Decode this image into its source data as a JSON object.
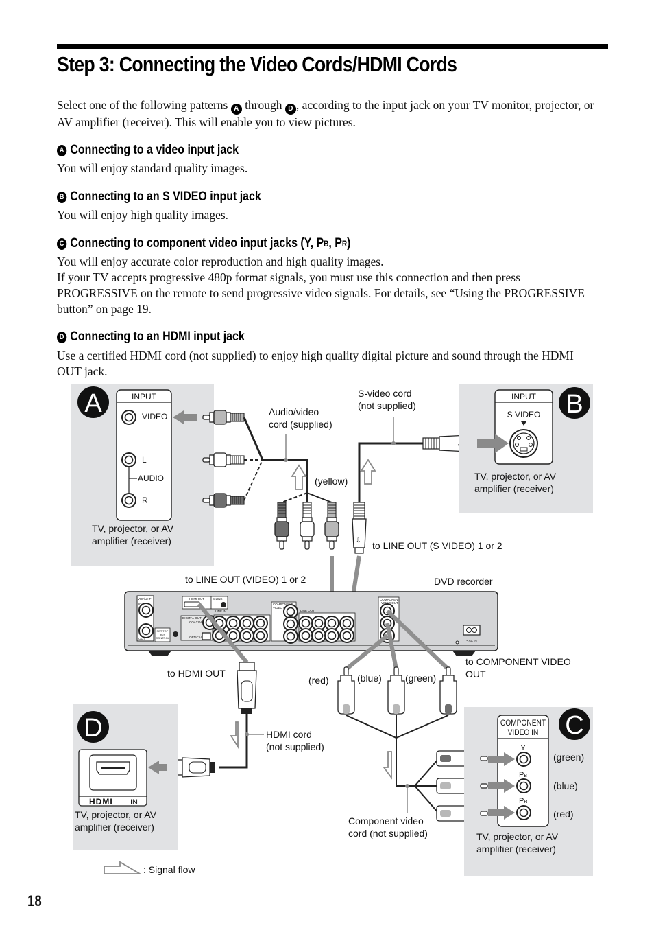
{
  "page": {
    "title": "Step 3: Connecting the Video Cords/HDMI Cords",
    "intro_before": "Select one of the following patterns ",
    "intro_badge_start": "A",
    "intro_mid": " through ",
    "intro_badge_end": "D",
    "intro_after": ", according to the input jack on your TV monitor, projector, or AV amplifier (receiver). This will enable you to view pictures.",
    "page_number": "18"
  },
  "sections": [
    {
      "badge": "A",
      "heading": "Connecting to a video input jack",
      "body": "You will enjoy standard quality images."
    },
    {
      "badge": "B",
      "heading": "Connecting to an S VIDEO input jack",
      "body": "You will enjoy high quality images."
    },
    {
      "badge": "C",
      "heading_main": "Connecting to component video input jacks (Y, P",
      "heading_sub1": "B",
      "heading_sep": ", P",
      "heading_sub2": "R",
      "heading_end": ")",
      "body1": "You will enjoy accurate color reproduction and high quality images.",
      "body2": "If your TV accepts progressive 480p format signals, you must use this connection and then press PROGRESSIVE on the remote to send progressive video signals. For details, see “Using the PROGRESSIVE button” on page 19."
    },
    {
      "badge": "D",
      "heading": "Connecting to an HDMI input jack",
      "body": "Use a certified HDMI cord (not supplied) to enjoy high quality digital picture and sound through the HDMI OUT jack."
    }
  ],
  "diagram": {
    "panel_a": {
      "letter": "A",
      "input_label": "INPUT",
      "video": "VIDEO",
      "l": "L",
      "audio": "AUDIO",
      "r": "R",
      "device_line1": "TV, projector, or AV",
      "device_line2": "amplifier (receiver)"
    },
    "panel_b": {
      "letter": "B",
      "input_label": "INPUT",
      "svideo": "S VIDEO",
      "device_line1": "TV, projector, or AV",
      "device_line2": "amplifier (receiver)"
    },
    "panel_c": {
      "letter": "C",
      "header1": "COMPONENT",
      "header2": "VIDEO IN",
      "y": "Y",
      "pb": "P",
      "pb_sub": "B",
      "pr": "P",
      "pr_sub": "R",
      "green": "(green)",
      "blue": "(blue)",
      "red": "(red)",
      "device_line1": "TV, projector, or AV",
      "device_line2": "amplifier (receiver)"
    },
    "panel_d": {
      "letter": "D",
      "hdmi_logo": "HDMI",
      "in_label": "IN",
      "device_line1": "TV, projector, or AV",
      "device_line2": "amplifier (receiver)"
    },
    "labels": {
      "av_cord1": "Audio/video",
      "av_cord2": "cord (supplied)",
      "svideo_cord1": "S-video cord",
      "svideo_cord2": "(not supplied)",
      "yellow": "(yellow)",
      "to_line_out_svideo": "to LINE OUT (S VIDEO) 1 or 2",
      "to_line_out_video": "to LINE OUT (VIDEO) 1 or 2",
      "dvd_recorder": "DVD recorder",
      "to_hdmi_out": "to HDMI OUT",
      "to_component1": "to COMPONENT VIDEO",
      "to_component2": "OUT",
      "red": "(red)",
      "blue": "(blue)",
      "green": "(green)",
      "hdmi_cord1": "HDMI cord",
      "hdmi_cord2": "(not supplied)",
      "comp_cord1": "Component video",
      "comp_cord2": "cord (not supplied)",
      "signal_flow": ": Signal flow"
    },
    "recorder_panel": {
      "vhf_uhf": "VHF/UHF",
      "in": "IN",
      "out": "OUT",
      "set_top1": "SET TOP",
      "set_top2": "BOX",
      "set_top3": "CONTROL",
      "hdmi_out": "HDMI OUT",
      "s_link": "S-LINK",
      "digital_out": "DIGITAL OUT",
      "coaxial": "COAXIAL",
      "optical": "OPTICAL",
      "line_in": "LINE IN",
      "component_in1": "COMPONENT",
      "component_in2": "VIDEO IN",
      "line_out": "LINE OUT",
      "component_out1": "COMPONENT",
      "component_out2": "VIDEO OUT",
      "ac_in": "~ AC IN"
    },
    "colors": {
      "panel_bg": "#e1e2e4",
      "arrow_gray": "#8a8a8a",
      "cable_gray": "#8f8f8f",
      "plug_dark": "#6e6e6e",
      "plug_mid": "#b8b8b8",
      "recorder_body": "#d4d5d7"
    }
  }
}
